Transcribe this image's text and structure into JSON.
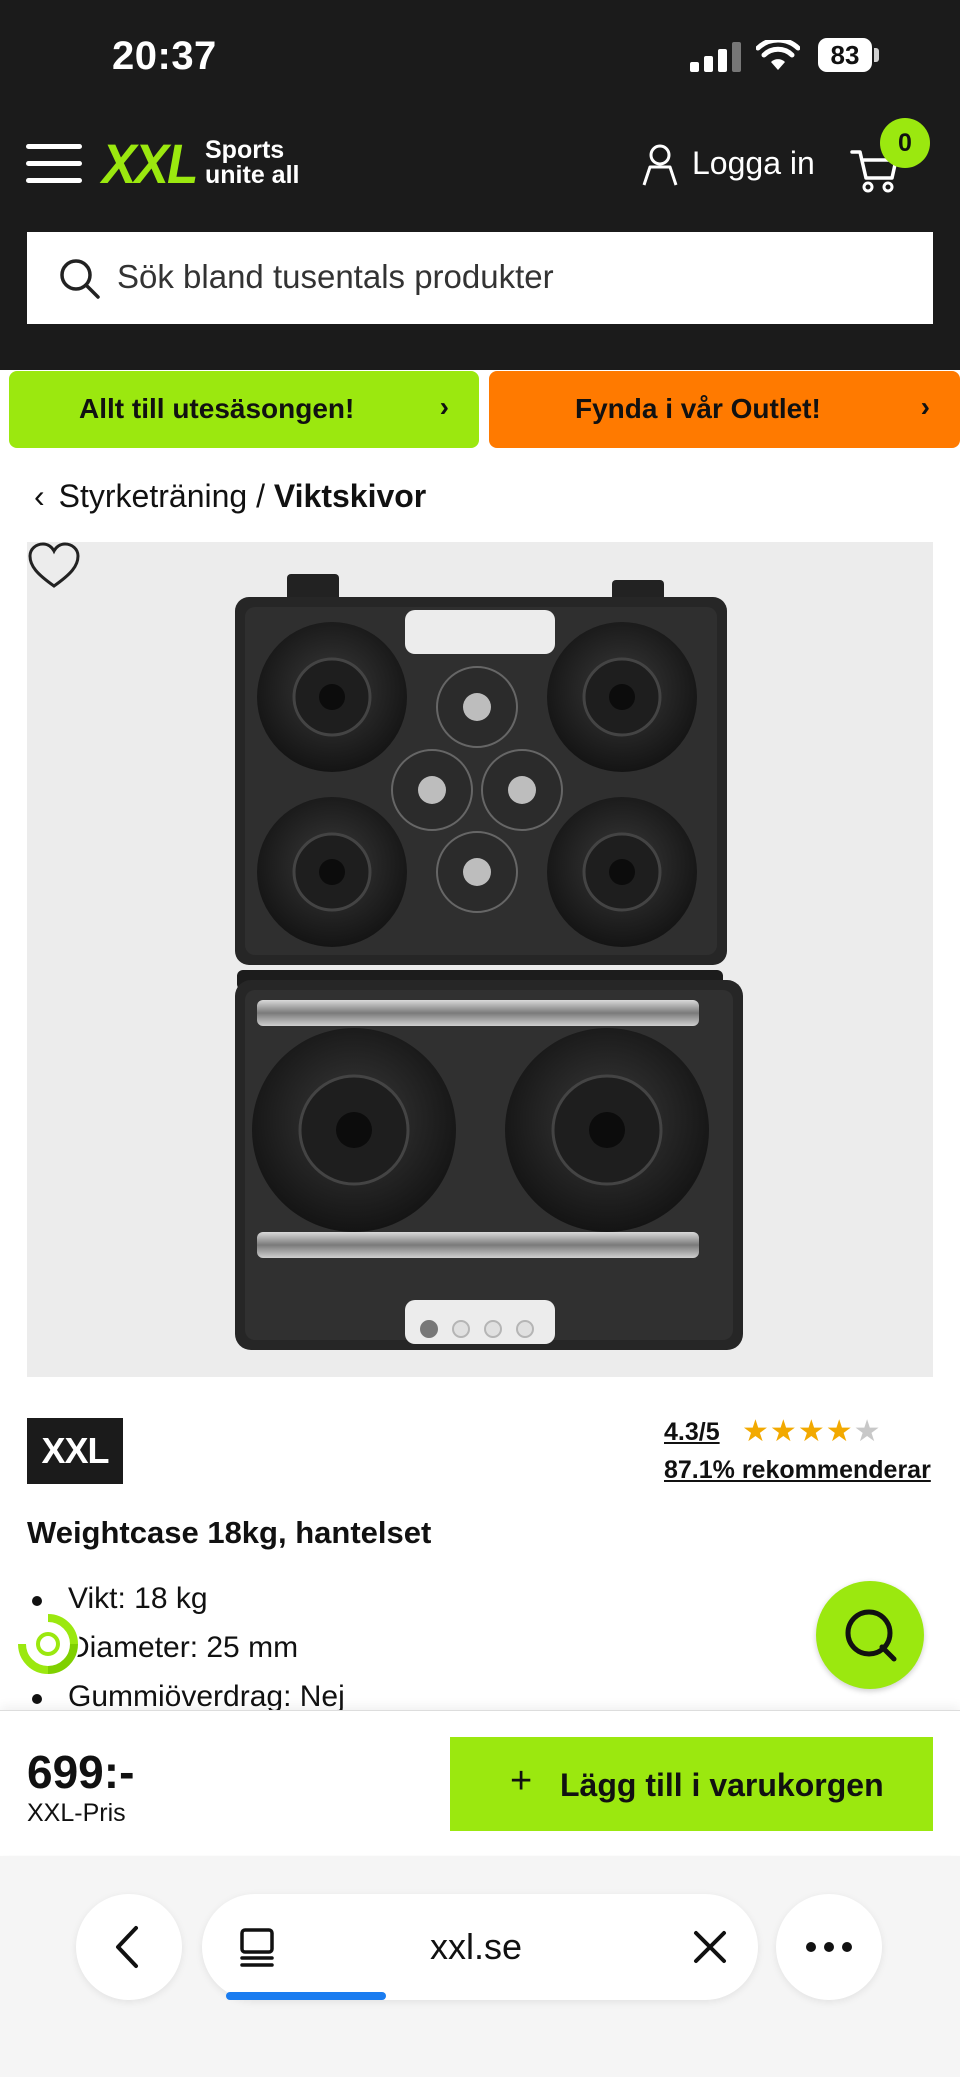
{
  "status_bar": {
    "time": "20:37",
    "battery": "83"
  },
  "header": {
    "logo": "XXL",
    "tagline_line1": "Sports",
    "tagline_line2": "unite all",
    "login_label": "Logga in",
    "cart_count": "0"
  },
  "search": {
    "placeholder": "Sök bland tusentals produkter"
  },
  "promos": [
    {
      "label": "Allt till utesäsongen!",
      "color": "#9be80f"
    },
    {
      "label": "Fynda i vår Outlet!",
      "color": "#ff7a00"
    }
  ],
  "breadcrumb": {
    "parent": "Styrketräning",
    "separator": "/",
    "current": "Viktskivor"
  },
  "gallery": {
    "image_count": 4,
    "active_index": 0
  },
  "product": {
    "brand": "XXL",
    "rating": "4.3/5",
    "rating_value": 4.3,
    "rating_max": 5,
    "recommend": "87.1% rekommenderar",
    "title": "Weightcase 18kg, hantelset",
    "specs": [
      "Vikt: 18 kg",
      "Diameter: 25 mm",
      "Gummiöverdrag: Nej"
    ]
  },
  "buy": {
    "price": "699:-",
    "price_label": "XXL-Pris",
    "add_to_cart": "Lägg till i varukorgen"
  },
  "browser": {
    "url": "xxl.se"
  },
  "colors": {
    "accent": "#9be80f",
    "outlet": "#ff7a00",
    "header_bg": "#1b1b1b",
    "star": "#f2a900"
  },
  "icons": [
    "hamburger-menu-icon",
    "user-icon",
    "cart-icon",
    "search-icon",
    "chevron-left-icon",
    "chevron-right-icon",
    "heart-icon",
    "chat-icon",
    "eco-badge-icon",
    "tabs-icon",
    "close-icon",
    "more-icon",
    "plus-icon"
  ]
}
